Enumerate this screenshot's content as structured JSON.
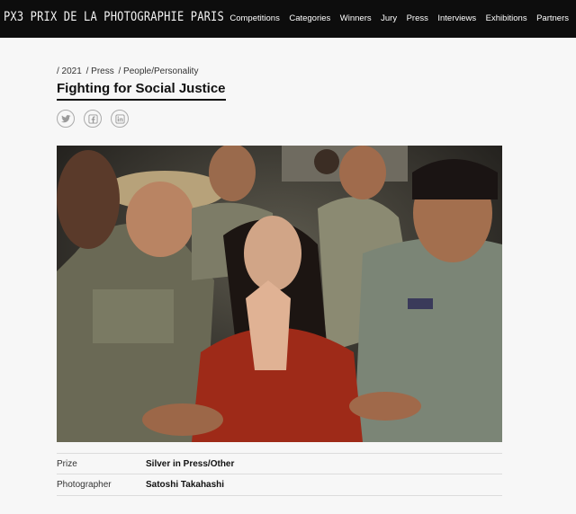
{
  "header": {
    "brand": "PX3 PRIX DE LA PHOTOGRAPHIE PARIS",
    "nav": [
      "Competitions",
      "Categories",
      "Winners",
      "Jury",
      "Press",
      "Interviews",
      "Exhibitions",
      "Partners"
    ]
  },
  "breadcrumb": {
    "items": [
      "/ 2021",
      "/ Press",
      "/ People/Personality"
    ]
  },
  "entry": {
    "title": "Fighting for Social Justice"
  },
  "share": {
    "icons": [
      "twitter-icon",
      "facebook-icon",
      "linkedin-icon"
    ]
  },
  "details": {
    "rows": [
      {
        "label": "Prize",
        "value": "Silver in Press/Other"
      },
      {
        "label": "Photographer",
        "value": "Satoshi Takahashi"
      }
    ]
  },
  "colors": {
    "header_bg": "#0d0d0d",
    "page_bg": "#f7f7f7",
    "divider": "#dcdcdc"
  }
}
